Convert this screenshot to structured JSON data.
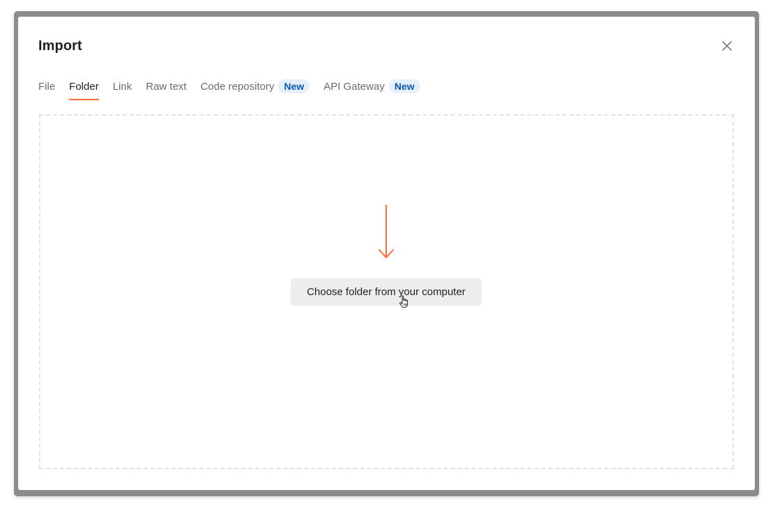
{
  "modal": {
    "title": "Import"
  },
  "tabs": [
    {
      "label": "File",
      "active": false
    },
    {
      "label": "Folder",
      "active": true
    },
    {
      "label": "Link",
      "active": false
    },
    {
      "label": "Raw text",
      "active": false
    },
    {
      "label": "Code repository",
      "active": false,
      "badge": "New"
    },
    {
      "label": "API Gateway",
      "active": false,
      "badge": "New"
    }
  ],
  "dropzone": {
    "button_label": "Choose folder from your computer"
  },
  "icons": {
    "close": "close-icon",
    "arrow": "arrow-down-icon",
    "cursor": "hand-pointer-cursor-icon"
  },
  "colors": {
    "accent": "#ff6c37",
    "badge_bg": "#e5f0fb",
    "badge_text": "#0a56b4",
    "frame": "#8c8c8c",
    "button_bg": "#ededed"
  }
}
